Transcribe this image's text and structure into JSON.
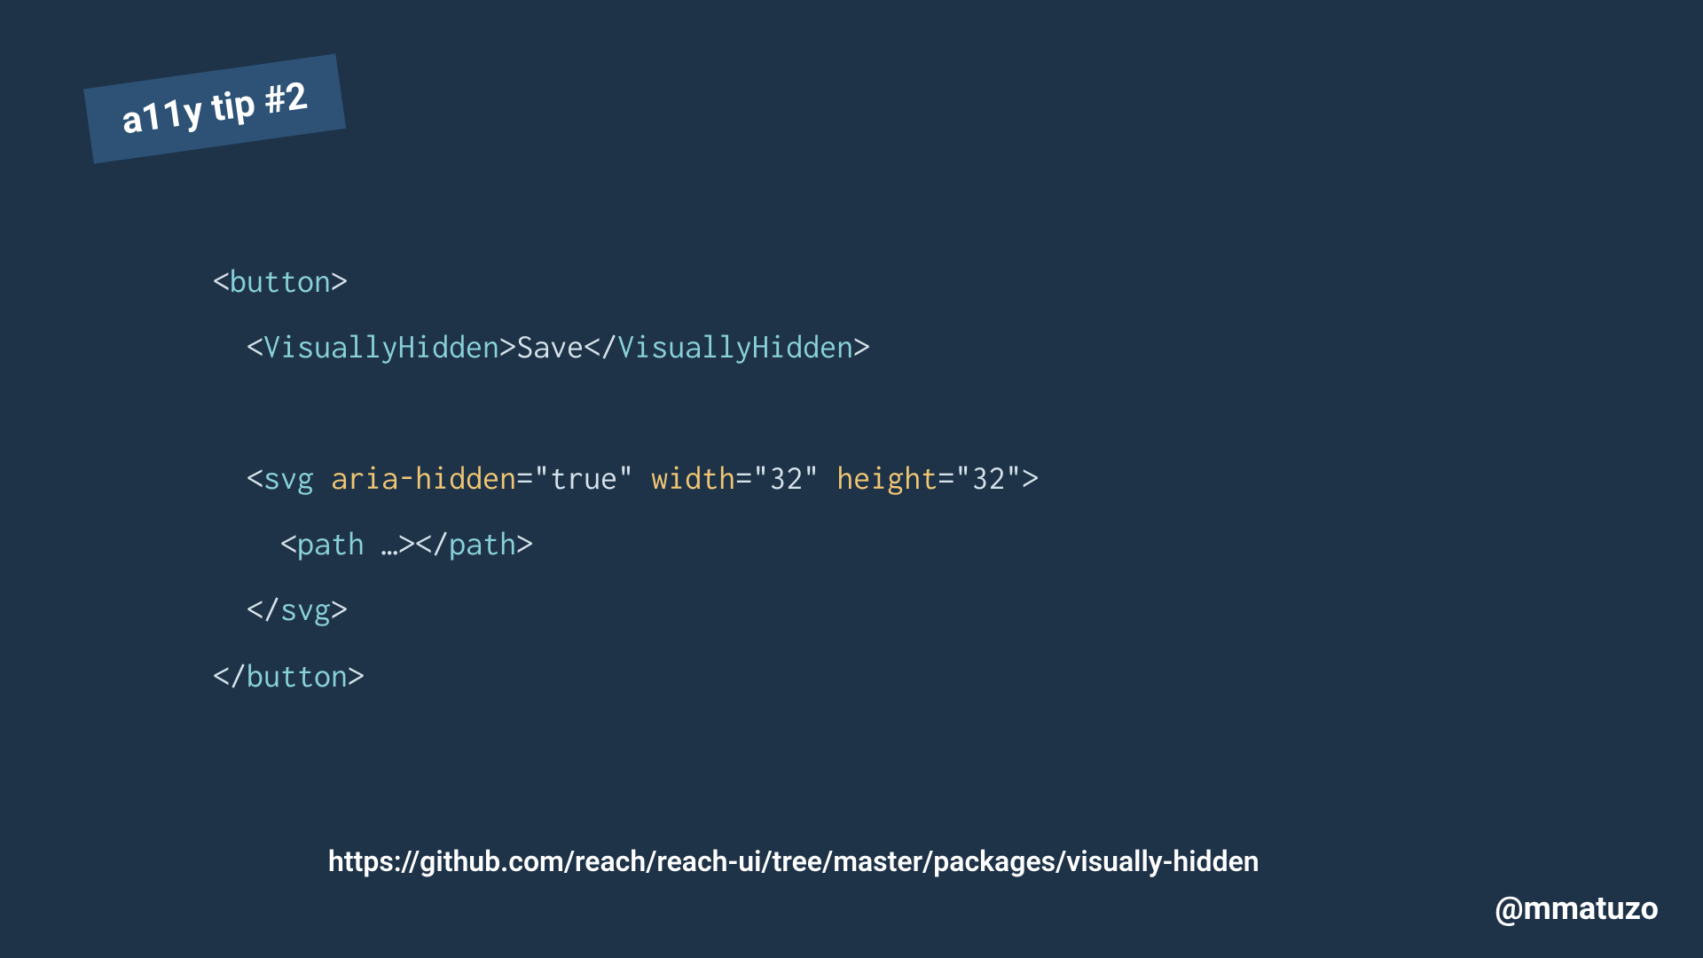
{
  "badge": {
    "label": "a11y tip #2"
  },
  "code": {
    "line1": {
      "open": "<",
      "tag": "button",
      "close": ">"
    },
    "line2": {
      "indent": "  ",
      "open": "<",
      "tag": "VisuallyHidden",
      "close": ">",
      "text": "Save",
      "open2": "</",
      "tag2": "VisuallyHidden",
      "close2": ">"
    },
    "line3": {
      "indent": "  ",
      "open": "<",
      "tag": "svg",
      "space1": " ",
      "attr1": "aria-hidden",
      "eq1": "=",
      "val1": "\"true\"",
      "space2": " ",
      "attr2": "width",
      "eq2": "=",
      "val2": "\"32\"",
      "space3": " ",
      "attr3": "height",
      "eq3": "=",
      "val3": "\"32\"",
      "close": ">"
    },
    "line4": {
      "indent": "    ",
      "open": "<",
      "tag": "path",
      "space": " ",
      "ellipsis": "…",
      "close": ">",
      "open2": "</",
      "tag2": "path",
      "close2": ">"
    },
    "line5": {
      "indent": "  ",
      "open": "</",
      "tag": "svg",
      "close": ">"
    },
    "line6": {
      "open": "</",
      "tag": "button",
      "close": ">"
    }
  },
  "link": {
    "url": "https://github.com/reach/reach-ui/tree/master/packages/visually-hidden"
  },
  "footer": {
    "handle": "@mmatuzo"
  }
}
